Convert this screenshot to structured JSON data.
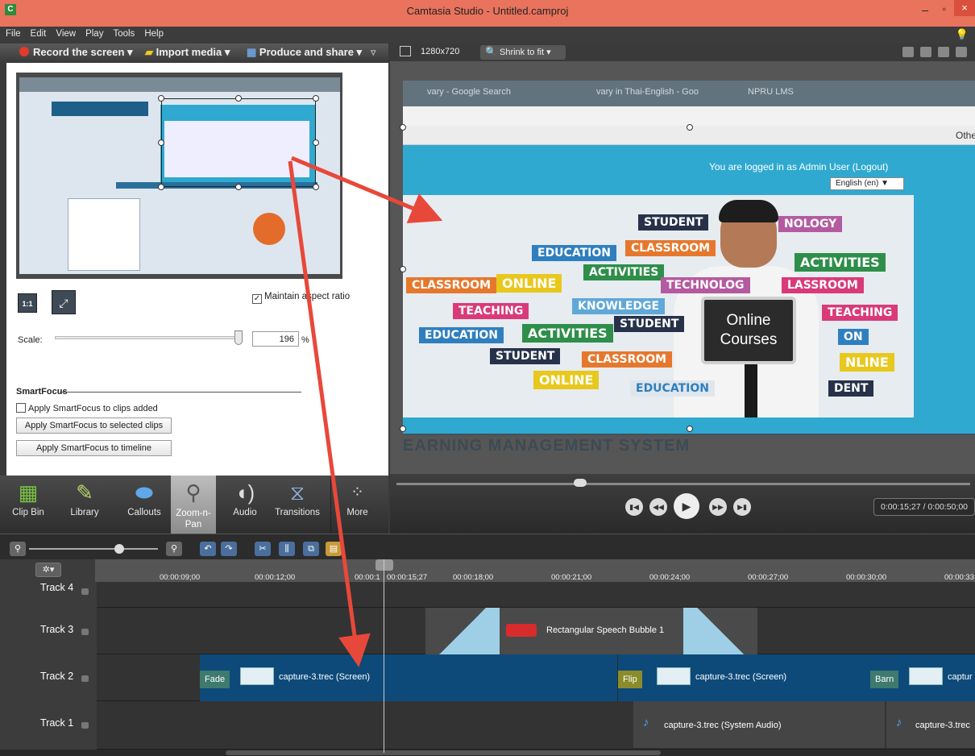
{
  "window": {
    "title": "Camtasia Studio - Untitled.camproj",
    "logo": "C",
    "minimize": "–",
    "maximize": "▫",
    "close": "×"
  },
  "menu": [
    "File",
    "Edit",
    "View",
    "Play",
    "Tools",
    "Help"
  ],
  "left_toolbar": {
    "record": "Record the screen ▾",
    "import": "Import media ▾",
    "produce": "Produce and share ▾",
    "overflow": "▿"
  },
  "right_toolbar": {
    "resolution": "1280x720",
    "zoom": "Shrink to fit ▾"
  },
  "zoom_panel": {
    "one_to_one": "1:1",
    "maintain_aspect": "Maintain aspect ratio",
    "scale_label": "Scale:",
    "scale_value": "196",
    "scale_unit": "%",
    "smartfocus_title": "SmartFocus",
    "apply_on_add": "Apply SmartFocus to clips added",
    "apply_selected": "Apply SmartFocus to selected clips",
    "apply_timeline": "Apply SmartFocus to timeline"
  },
  "tabs": [
    {
      "label": "Clip Bin",
      "icon": "film-icon"
    },
    {
      "label": "Library",
      "icon": "library-icon"
    },
    {
      "label": "Callouts",
      "icon": "callout-icon"
    },
    {
      "label": "Zoom-n-\nPan",
      "icon": "zoom-icon"
    },
    {
      "label": "Audio",
      "icon": "speaker-icon"
    },
    {
      "label": "Transitions",
      "icon": "transition-icon"
    },
    {
      "label": "More",
      "icon": "more-icon"
    }
  ],
  "canvas": {
    "login": "You are logged in as Admin User (Logout)",
    "language": "English (en) ▼",
    "sign_line1": "Online",
    "sign_line2": "Courses",
    "footer": "EARNING MANAGEMENT SYSTEM",
    "browser_tab1": "vary - Google Search",
    "browser_tab2": "vary in Thai-English - Goo",
    "browser_tab3": "NPRU LMS",
    "bookmark": "Othe",
    "words": [
      "STUDENT",
      "NOLOGY",
      "EDUCATION",
      "CLASSROOM",
      "ACTIVITIES",
      "ACTIVITIES",
      "CLASSROOM",
      "ONLINE",
      "TECHNOLOG",
      "LASSROOM",
      "TEACHING",
      "KNOWLEDGE",
      "TEACHING",
      "EDUCATION",
      "ACTIVITIES",
      "STUDENT",
      "ON",
      "STUDENT",
      "CLASSROOM",
      "NLINE",
      "ONLINE",
      "EDUCATION",
      "DENT"
    ]
  },
  "playback": {
    "time": "0:00:15;27 / 0:00:50;00"
  },
  "ruler": {
    "ticks": [
      "00:00:09;00",
      "00:00:12;00",
      "00:00:1",
      "00:00:15;27",
      "00:00:18;00",
      "00:00:21;00",
      "00:00:24;00",
      "00:00:27;00",
      "00:00:30;00",
      "00:00:33;"
    ]
  },
  "tracks": [
    {
      "name": "Track 4"
    },
    {
      "name": "Track 3",
      "clips": [
        {
          "label": "Rectangular Speech Bubble 1"
        }
      ]
    },
    {
      "name": "Track 2",
      "transitions": [
        "Fade",
        "Flip",
        "Barn"
      ],
      "clips": [
        {
          "label": "capture-3.trec (Screen)"
        },
        {
          "label": "capture-3.trec (Screen)"
        },
        {
          "label": "captur"
        }
      ]
    },
    {
      "name": "Track 1",
      "clips": [
        {
          "label": "capture-3.trec (System Audio)"
        },
        {
          "label": "capture-3.trec"
        }
      ]
    }
  ],
  "colors": {
    "titlebar": "#e9735d",
    "arrow": "#e8483a",
    "track_clip": "#0d4a7a",
    "transition": "#3e7a6e"
  }
}
